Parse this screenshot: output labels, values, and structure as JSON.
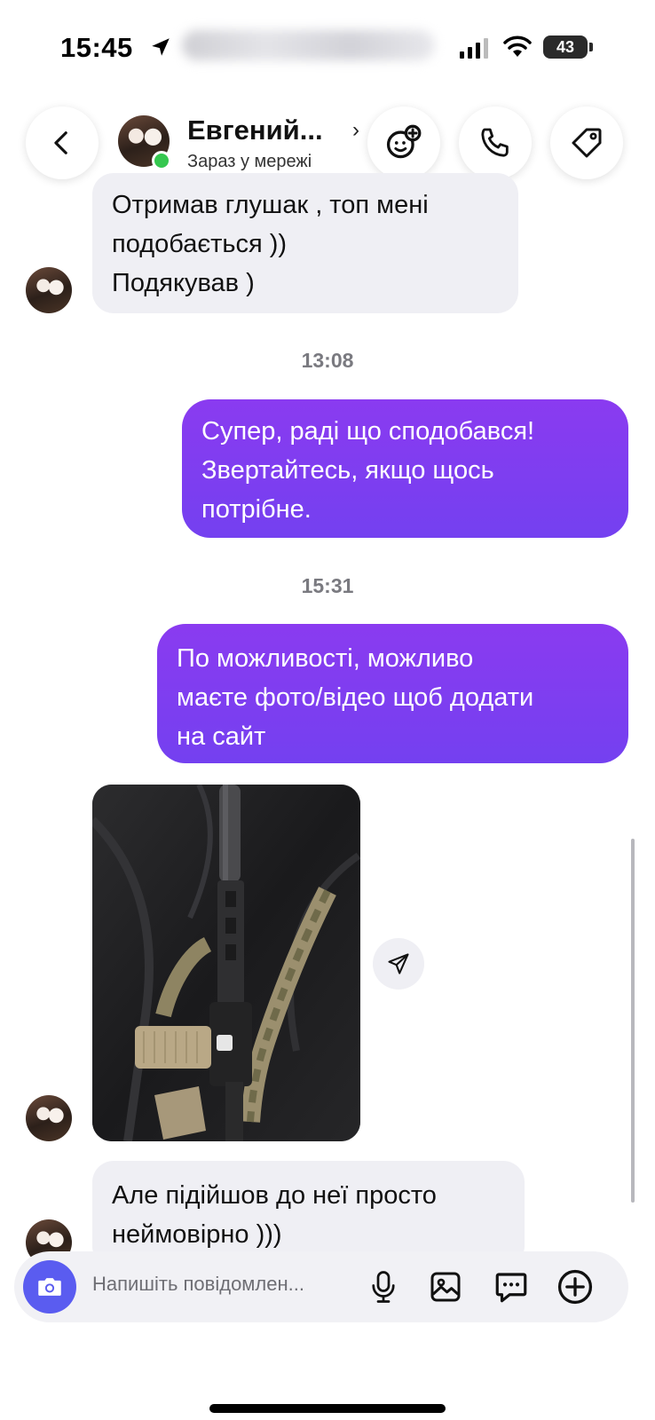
{
  "status_bar": {
    "time": "15:45",
    "battery": "43"
  },
  "header": {
    "contact_name": "Евгений...",
    "chevron": "›",
    "status": "Зараз у мережі",
    "icons": [
      "back-icon",
      "effects-icon",
      "phone-icon",
      "tag-icon"
    ]
  },
  "messages": [
    {
      "type": "incoming",
      "lines": [
        "Отримав глушак , топ мені",
        "подобається ))",
        "Подякував )"
      ]
    },
    {
      "type": "timestamp",
      "text": "13:08"
    },
    {
      "type": "outgoing",
      "lines": [
        "Супер, раді що сподобався!",
        "Звертайтесь, якщо щось",
        "потрібне."
      ]
    },
    {
      "type": "timestamp",
      "text": "15:31"
    },
    {
      "type": "outgoing",
      "lines": [
        "По можливості, можливо",
        "маєте фото/відео щоб додати",
        "на сайт"
      ]
    },
    {
      "type": "incoming-photo"
    },
    {
      "type": "incoming",
      "lines": [
        "Але підійшов до неї просто",
        "неймовірно )))"
      ]
    }
  ],
  "composer": {
    "placeholder": "Напишіть повідомлен...",
    "icons": [
      "camera-icon",
      "microphone-icon",
      "gallery-icon",
      "sticker-icon",
      "plus-icon"
    ]
  },
  "colors": {
    "outgoing_bubble": "#7a3ff0",
    "incoming_bubble": "#efeff4",
    "camera_button": "#5a5cf0",
    "online": "#35c74f"
  }
}
